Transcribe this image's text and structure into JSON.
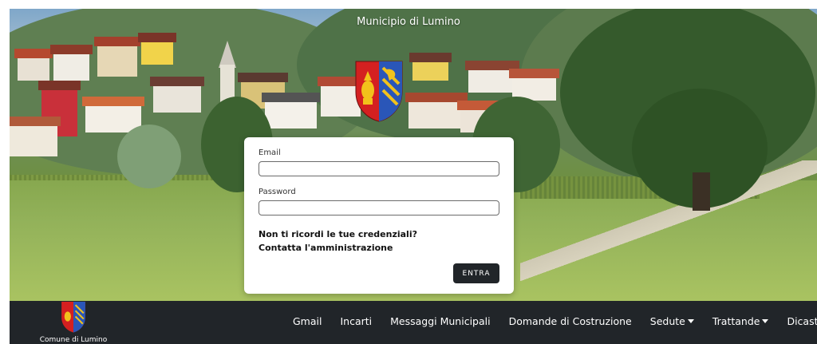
{
  "site": {
    "title": "Municipio di Lumino"
  },
  "login": {
    "email_label": "Email",
    "email_value": "",
    "password_label": "Password",
    "password_value": "",
    "forgot_line1": "Non ti ricordi le tue credenziali?",
    "forgot_line2": "Contatta l'amministrazione",
    "submit_label": "ENTRA"
  },
  "navbar": {
    "brand_label": "Comune di Lumino",
    "items": [
      {
        "label": "Gmail",
        "dropdown": false
      },
      {
        "label": "Incarti",
        "dropdown": false
      },
      {
        "label": "Messaggi Municipali",
        "dropdown": false
      },
      {
        "label": "Domande di Costruzione",
        "dropdown": false
      },
      {
        "label": "Sedute",
        "dropdown": true
      },
      {
        "label": "Trattande",
        "dropdown": true
      },
      {
        "label": "Dicasteri",
        "dropdown": true
      }
    ]
  },
  "colors": {
    "navbar_bg": "#212529",
    "button_bg": "#212529",
    "coat_red": "#d42020",
    "coat_gold": "#f2c21b",
    "coat_blue": "#2a56b8"
  },
  "icons": {
    "coat_of_arms": "lumino-coat-of-arms",
    "dropdown": "caret-down-icon"
  }
}
